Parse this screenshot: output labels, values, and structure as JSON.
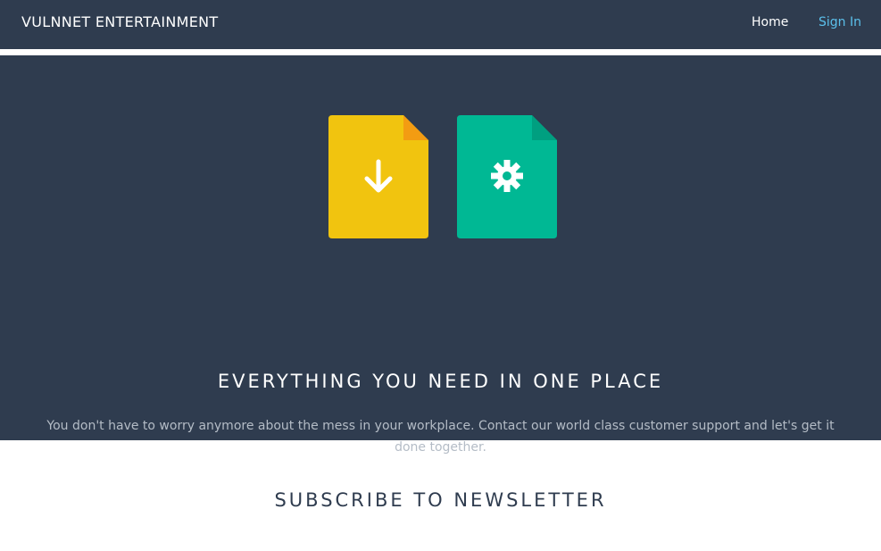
{
  "navbar": {
    "brand": "VULNNET ENTERTAINMENT",
    "links": [
      {
        "label": "Home"
      },
      {
        "label": "Sign In"
      }
    ]
  },
  "hero": {
    "icons": [
      {
        "name": "download-file-icon",
        "color": "#f1c40f",
        "fold_color": "#f39c12"
      },
      {
        "name": "settings-file-icon",
        "color": "#00b894",
        "fold_color": "#009f80"
      }
    ],
    "title": "EVERYTHING YOU NEED IN ONE PLACE",
    "text": "You don't have to worry anymore about the mess in your workplace. Contact our world class customer support and let's get it done together."
  },
  "newsletter": {
    "title": "SUBSCRIBE TO NEWSLETTER"
  },
  "colors": {
    "navbar_bg": "#2f3c4f",
    "hero_bg": "#2f3c4f",
    "link_accent": "#5bc0eb"
  }
}
